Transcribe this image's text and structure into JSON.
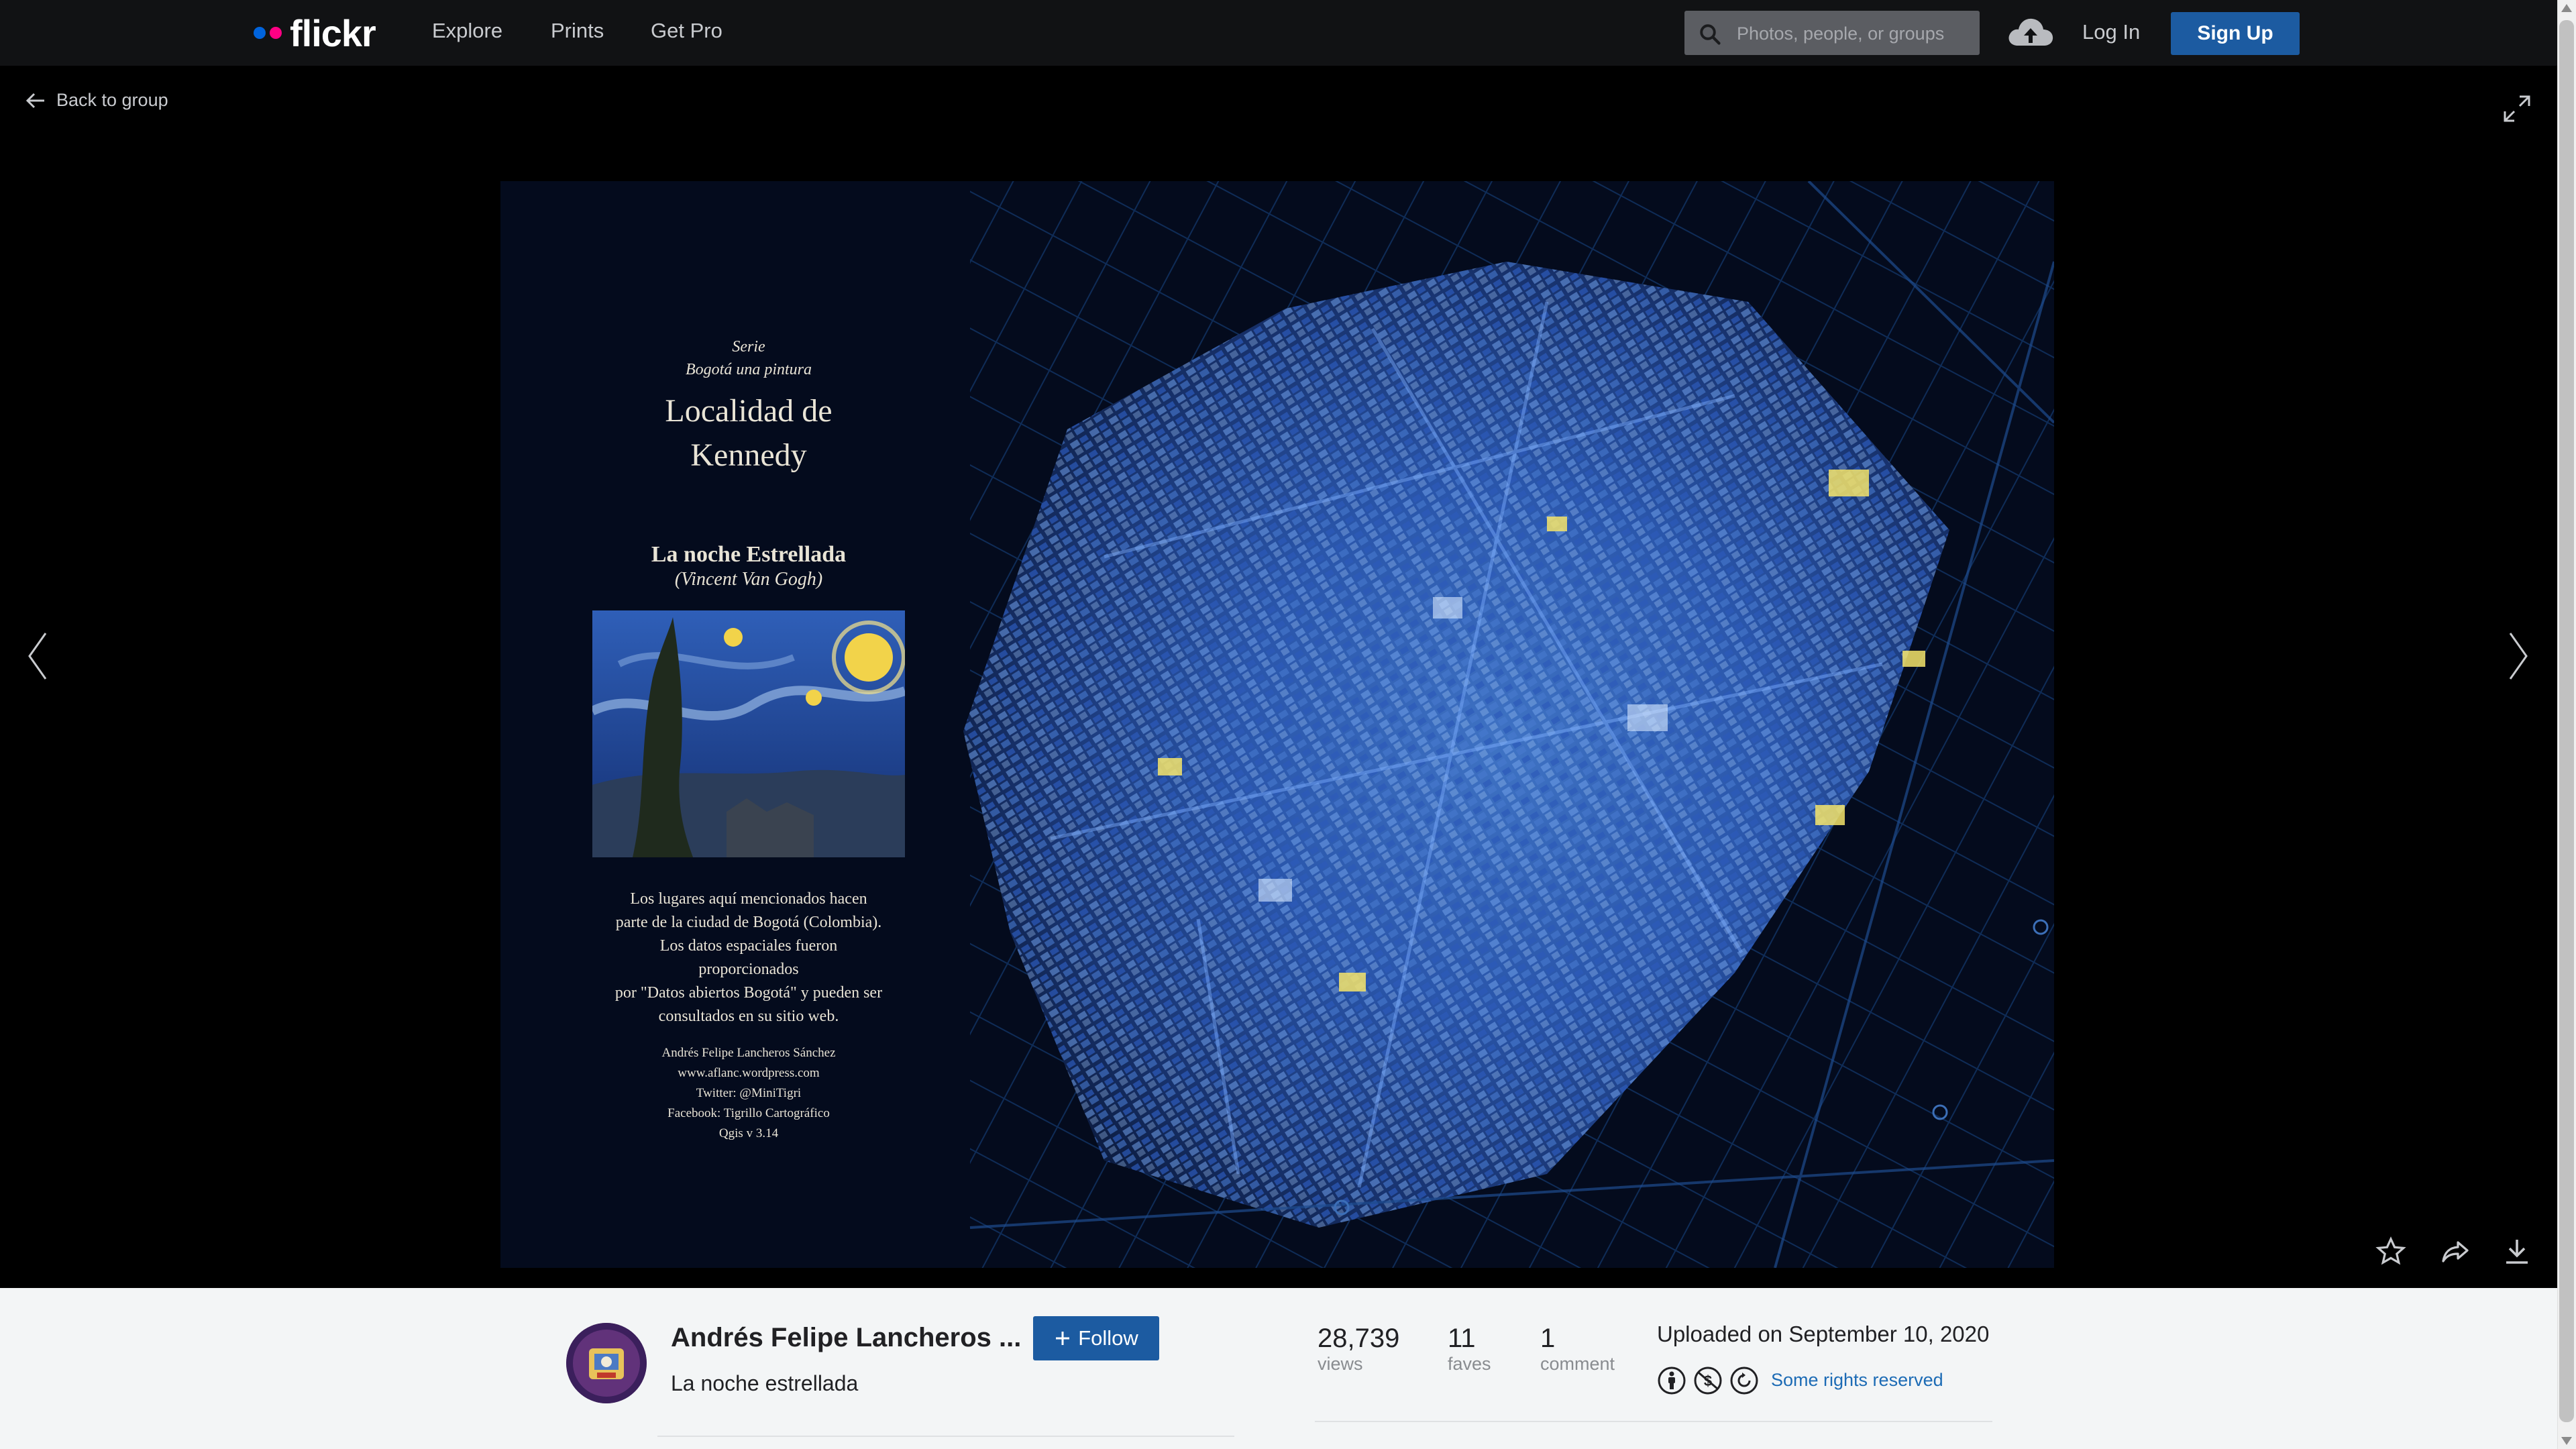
{
  "nav": {
    "logo": "flickr",
    "links": [
      "Explore",
      "Prints",
      "Get Pro"
    ],
    "search_placeholder": "Photos, people, or groups",
    "login": "Log In",
    "signup": "Sign Up"
  },
  "stage": {
    "back_label": "Back to group"
  },
  "photo_text": {
    "serie": "Serie",
    "series_name": "Bogotá una pintura",
    "title_line1": "Localidad de",
    "title_line2": "Kennedy",
    "subtitle": "La noche Estrellada",
    "painting_author": "(Vincent Van Gogh)",
    "desc_lines": [
      "Los lugares aquí mencionados hacen",
      "parte de la ciudad de Bogotá (Colombia).",
      "Los datos espaciales fueron proporcionados",
      "por \"Datos abiertos Bogotá\" y pueden ser",
      "consultados en su sitio web."
    ],
    "credit_lines": [
      "Andrés Felipe Lancheros Sánchez",
      "www.aflanc.wordpress.com",
      "Twitter: @MiniTigri",
      "Facebook: Tigrillo Cartográfico",
      "Qgis v 3.14"
    ]
  },
  "info": {
    "owner_name": "Andrés Felipe Lancheros ...",
    "follow_label": "Follow",
    "photo_title": "La noche estrellada",
    "stats": [
      {
        "value": "28,739",
        "label": "views"
      },
      {
        "value": "11",
        "label": "faves"
      },
      {
        "value": "1",
        "label": "comment"
      }
    ],
    "uploaded": "Uploaded on September 10, 2020",
    "rights": "Some rights reserved"
  },
  "colors": {
    "brand_blue": "#0063dc",
    "brand_pink": "#ff0084",
    "button": "#1c5ba1",
    "link": "#1c6bb5"
  }
}
